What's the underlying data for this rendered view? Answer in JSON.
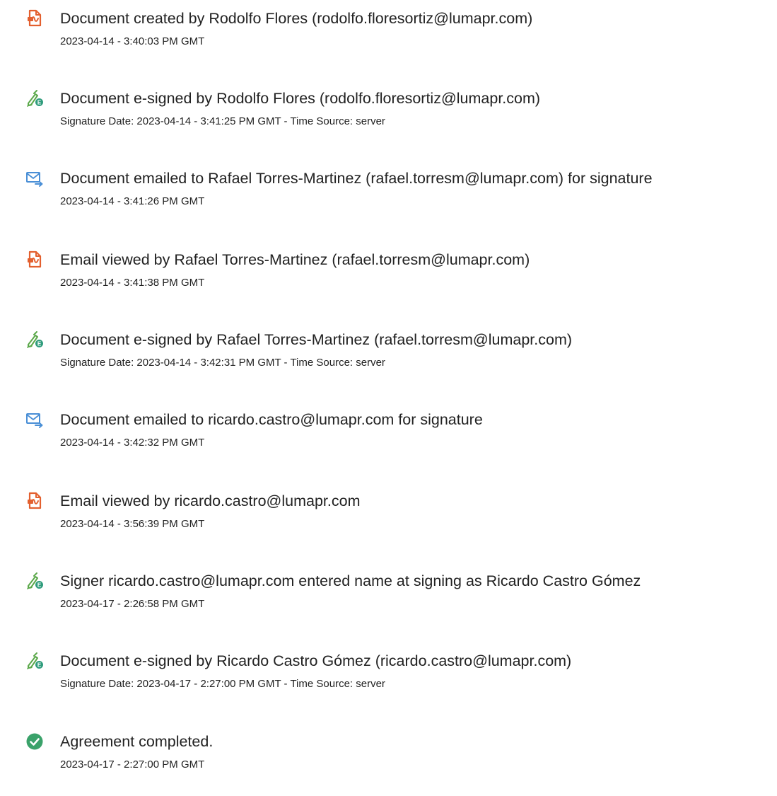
{
  "colors": {
    "doc_icon": "#e3602f",
    "sign_icon": "#5ba84a",
    "sign_badge": "#2f9c7c",
    "email_icon": "#4a8fd6",
    "complete_icon": "#3aa26a",
    "text": "#222222"
  },
  "events": [
    {
      "icon": "document-icon",
      "title": "Document created by Rodolfo Flores (rodolfo.floresortiz@lumapr.com)",
      "meta": "2023-04-14 - 3:40:03 PM GMT"
    },
    {
      "icon": "esign-icon",
      "title": "Document e-signed by Rodolfo Flores (rodolfo.floresortiz@lumapr.com)",
      "meta": "Signature Date: 2023-04-14 - 3:41:25 PM GMT - Time Source: server"
    },
    {
      "icon": "email-icon",
      "title": "Document emailed to Rafael Torres-Martinez (rafael.torresm@lumapr.com) for signature",
      "meta": "2023-04-14 - 3:41:26 PM GMT"
    },
    {
      "icon": "document-icon",
      "title": "Email viewed by Rafael Torres-Martinez (rafael.torresm@lumapr.com)",
      "meta": "2023-04-14 - 3:41:38 PM GMT"
    },
    {
      "icon": "esign-icon",
      "title": "Document e-signed by Rafael Torres-Martinez (rafael.torresm@lumapr.com)",
      "meta": "Signature Date: 2023-04-14 - 3:42:31 PM GMT - Time Source: server"
    },
    {
      "icon": "email-icon",
      "title": "Document emailed to ricardo.castro@lumapr.com for signature",
      "meta": "2023-04-14 - 3:42:32 PM GMT"
    },
    {
      "icon": "document-icon",
      "title": "Email viewed by ricardo.castro@lumapr.com",
      "meta": "2023-04-14 - 3:56:39 PM GMT"
    },
    {
      "icon": "esign-icon",
      "title": "Signer ricardo.castro@lumapr.com entered name at signing as Ricardo Castro Gómez",
      "meta": "2023-04-17 - 2:26:58 PM GMT"
    },
    {
      "icon": "esign-icon",
      "title": "Document e-signed by Ricardo Castro Gómez (ricardo.castro@lumapr.com)",
      "meta": "Signature Date: 2023-04-17 - 2:27:00 PM GMT - Time Source: server"
    },
    {
      "icon": "check-circle-icon",
      "title": "Agreement completed.",
      "meta": "2023-04-17 - 2:27:00 PM GMT"
    }
  ]
}
